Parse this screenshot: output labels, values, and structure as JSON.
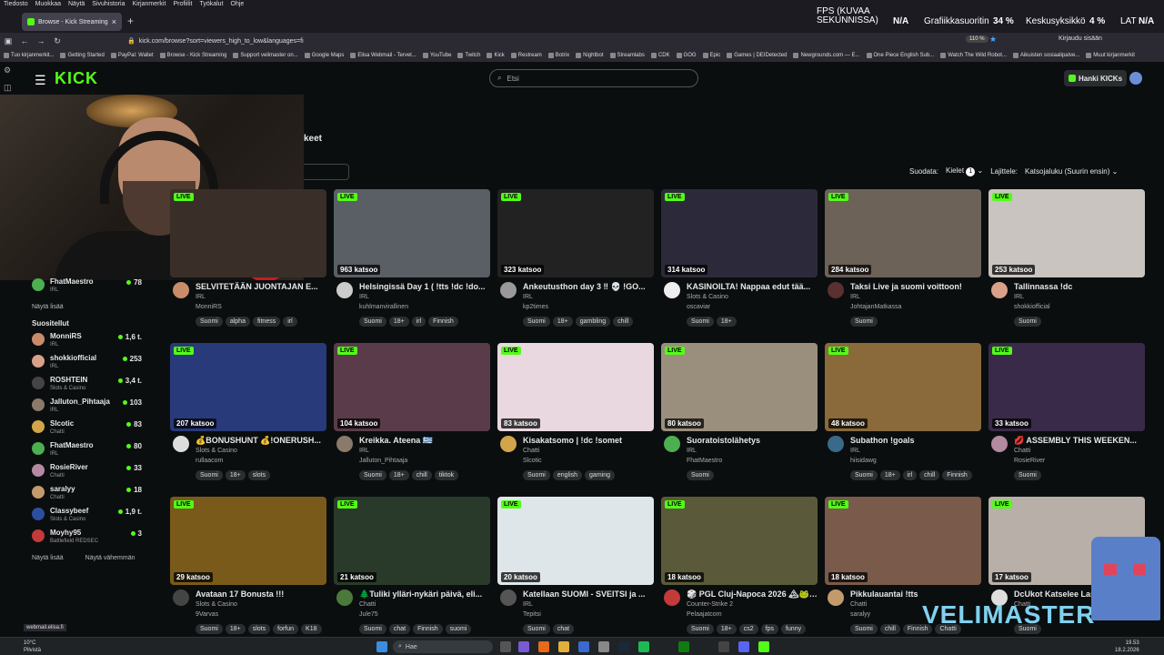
{
  "menubar": [
    "Tiedosto",
    "Muokkaa",
    "Näytä",
    "Sivuhistoria",
    "Kirjanmerkit",
    "Profiilit",
    "Työkalut",
    "Ohje"
  ],
  "tab": {
    "title": "Browse - Kick Streaming",
    "close": "×",
    "new": "+"
  },
  "url": "kick.com/browse?sort=viewers_high_to_low&languages=fi",
  "zoom": "110 %",
  "login": "Kirjaudu sisään",
  "bookmarks": [
    "Tuo kirjanmerkit...",
    "Getting Started",
    "PayPal: Wallet",
    "Browse - Kick Streaming",
    "Support velimaster on...",
    "Google Maps",
    "Elisa Webmail - Tervet...",
    "YouTube",
    "Twitch",
    "Kick",
    "Restream",
    "Botrix",
    "Nightbot",
    "Streamlabs",
    "CDK",
    "GOG",
    "Epic",
    "Games | DEIDetected",
    "Newgrounds.com — E...",
    "One Piece English Sub...",
    "Watch The Wild Robot...",
    "Aikuisten sosiaalipalve...",
    "Muut kirjanmerkit"
  ],
  "overlay": {
    "fps_label": "FPS (KUVAA SEKUNNISSA)",
    "fps_value": "N/A",
    "gpu_label": "Grafiikkasuoritin",
    "gpu_value": "34 %",
    "cpu_label": "Keskusyksikkö",
    "cpu_value": "4 %",
    "lat_label": "LAT",
    "lat_value": "N/A"
  },
  "kick": {
    "logo": "KICK",
    "search_placeholder": "Etsi",
    "get_kicks": "Hanki KICKs",
    "heading": "keet",
    "filters": {
      "label": "Suodata:",
      "languages": "Kielet",
      "lang_count": "1",
      "sort_label": "Lajittele:",
      "sort_value": "Katsojaluku (Suurin ensin)"
    }
  },
  "sidebar": {
    "top_row": {
      "name": "FhatMaestro",
      "cat": "IRL",
      "count": "78"
    },
    "show_more": "Näytä lisää",
    "section": "Suositellut",
    "items": [
      {
        "name": "MonniRS",
        "cat": "IRL",
        "count": "1,6 t.",
        "color": "#c98c6b"
      },
      {
        "name": "shokkiofficial",
        "cat": "IRL",
        "count": "253",
        "color": "#d9a08a"
      },
      {
        "name": "ROSHTEIN",
        "cat": "Slots & Casino",
        "count": "3,4 t.",
        "color": "#444"
      },
      {
        "name": "Jalluton_Pihtaaja",
        "cat": "IRL",
        "count": "103",
        "color": "#8a7a6a"
      },
      {
        "name": "Slcotic",
        "cat": "Chatti",
        "count": "83",
        "color": "#d2a54a"
      },
      {
        "name": "FhatMaestro",
        "cat": "IRL",
        "count": "80",
        "color": "#4caf50"
      },
      {
        "name": "RosieRiver",
        "cat": "Chatti",
        "count": "33",
        "color": "#b48aa0"
      },
      {
        "name": "saralyy",
        "cat": "Chatti",
        "count": "18",
        "color": "#c49a6c"
      },
      {
        "name": "Classybeef",
        "cat": "Slots & Casino",
        "count": "1,9 t.",
        "color": "#2b4f9e"
      },
      {
        "name": "Moyhy95",
        "cat": "Battlefield REDSEC",
        "count": "3",
        "color": "#c23a3a"
      }
    ],
    "footer_more": "Näytä lisää",
    "footer_less": "Näytä vähemmän"
  },
  "live_label": "LIVE",
  "cards": [
    {
      "viewers": "",
      "title": "SELVITETÄÄN JUONTAJAN E...",
      "cat": "IRL",
      "name": "MonniRS",
      "tags": [
        "Suomi",
        "alpha",
        "fitness",
        "irl"
      ],
      "thumb": "#3a2e28",
      "av": "#c98c6b"
    },
    {
      "viewers": "963 katsoo",
      "title": "Helsingissä Day 1 ( !tts !dc !do...",
      "cat": "IRL",
      "name": "kuhlmanvirallinen",
      "tags": [
        "Suomi",
        "18+",
        "irl",
        "Finnish"
      ],
      "thumb": "#5a5f66",
      "av": "#ccc"
    },
    {
      "viewers": "323 katsoo",
      "title": "Ankeutusthon day 3 ‼ 💀 !GO...",
      "cat": "IRL",
      "name": "kp2times",
      "tags": [
        "Suomi",
        "18+",
        "gambling",
        "chill"
      ],
      "thumb": "#222",
      "av": "#999"
    },
    {
      "viewers": "314 katsoo",
      "title": "KASINOILTA! Nappaa edut tää...",
      "cat": "Slots & Casino",
      "name": "oscaviar",
      "tags": [
        "Suomi",
        "18+"
      ],
      "thumb": "#2c2a3a",
      "av": "#eee"
    },
    {
      "viewers": "284 katsoo",
      "title": "Taksi Live ja suomi voittoon!",
      "cat": "IRL",
      "name": "JohtajanMatkassa",
      "tags": [
        "Suomi"
      ],
      "thumb": "#6d6258",
      "av": "#5a3030"
    },
    {
      "viewers": "253 katsoo",
      "title": "Tallinnassa !dc",
      "cat": "IRL",
      "name": "shokkiofficial",
      "tags": [
        "Suomi"
      ],
      "thumb": "#c9c4bf",
      "av": "#d9a08a"
    },
    {
      "viewers": "207 katsoo",
      "title": "💰BONUSHUNT 💰!ONERUSH...",
      "cat": "Slots & Casino",
      "name": "rullaacom",
      "tags": [
        "Suomi",
        "18+",
        "slots"
      ],
      "thumb": "#283a7a",
      "av": "#ddd"
    },
    {
      "viewers": "104 katsoo",
      "title": "Kreikka. Ateena 🇬🇷",
      "cat": "IRL",
      "name": "Jalluton_Pihtaaja",
      "tags": [
        "Suomi",
        "18+",
        "chill",
        "tiktok"
      ],
      "thumb": "#5a3b4a",
      "av": "#8a7a6a"
    },
    {
      "viewers": "83 katsoo",
      "title": "Kisakatsomo | !dc !somet",
      "cat": "Chatti",
      "name": "Slcotic",
      "tags": [
        "Suomi",
        "english",
        "gaming"
      ],
      "thumb": "#e9d8e0",
      "av": "#d2a54a"
    },
    {
      "viewers": "80 katsoo",
      "title": "Suoratoistolähetys",
      "cat": "IRL",
      "name": "FhatMaestro",
      "tags": [
        "Suomi"
      ],
      "thumb": "#9a8f7c",
      "av": "#4caf50"
    },
    {
      "viewers": "48 katsoo",
      "title": "Subathon !goals",
      "cat": "IRL",
      "name": "hiisidawg",
      "tags": [
        "Suomi",
        "18+",
        "irl",
        "chill",
        "Finnish"
      ],
      "thumb": "#8a6a3a",
      "av": "#3a6a8a"
    },
    {
      "viewers": "33 katsoo",
      "title": "💋 ASSEMBLY THIS WEEKEN...",
      "cat": "Chatti",
      "name": "RosieRiver",
      "tags": [
        "Suomi"
      ],
      "thumb": "#3a2a4a",
      "av": "#b48aa0"
    },
    {
      "viewers": "29 katsoo",
      "title": "Avataan 17 Bonusta !!!",
      "cat": "Slots & Casino",
      "name": "9Varvas",
      "tags": [
        "Suomi",
        "18+",
        "slots",
        "forfun",
        "K18"
      ],
      "thumb": "#7a5a1a",
      "av": "#444"
    },
    {
      "viewers": "21 katsoo",
      "title": "🌲Tuliki ylläri-nykäri päivä, eli...",
      "cat": "Chatti",
      "name": "Jule75",
      "tags": [
        "Suomi",
        "chat",
        "Finnish",
        "suomi"
      ],
      "thumb": "#2a3a2a",
      "av": "#4a7a3a"
    },
    {
      "viewers": "20 katsoo",
      "title": "Katellaan SUOMI - SVEITSI ja ...",
      "cat": "IRL",
      "name": "Tepitsi",
      "tags": [
        "Suomi",
        "chat"
      ],
      "thumb": "#dfe6ea",
      "av": "#555"
    },
    {
      "viewers": "18 katsoo",
      "title": "🎲 PGL Cluj-Napoca 2026 🏔🐸 ...",
      "cat": "Counter-Strike 2",
      "name": "Pelaajatcom",
      "tags": [
        "Suomi",
        "18+",
        "cs2",
        "fps",
        "funny"
      ],
      "thumb": "#5a5a3a",
      "av": "#c23a3a"
    },
    {
      "viewers": "18 katsoo",
      "title": "Pikkulauantai !tts",
      "cat": "Chatti",
      "name": "saralyy",
      "tags": [
        "Suomi",
        "chill",
        "Finnish",
        "Chatti"
      ],
      "thumb": "#7a5a4a",
      "av": "#c49a6c"
    },
    {
      "viewers": "17 katsoo",
      "title": "DcUkot Katselee Las...",
      "cat": "Chatti",
      "name": "",
      "tags": [
        "Suomi"
      ],
      "thumb": "#b8b0a8",
      "av": "#ddd"
    }
  ],
  "watermark": "VELIMASTER",
  "taskbar": {
    "temp": "10°C",
    "weather": "Pilvistä",
    "search": "Hae",
    "time": "19.53",
    "date": "18.2.2026"
  },
  "status_url": "webmail.elisa.fi"
}
